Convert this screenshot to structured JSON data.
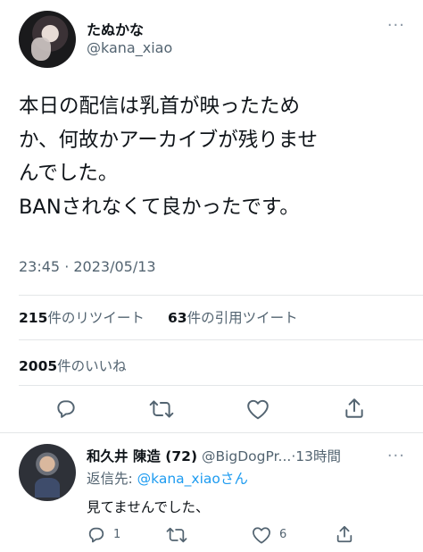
{
  "tweet": {
    "display_name": "たぬかな",
    "handle": "@kana_xiao",
    "more_glyph": "···",
    "text": "本日の配信は乳首が映ったため\nか、何故かアーカイブが残りませ\nんでした。\nBANされなくて良かったです。",
    "timestamp": "23:45 · 2023/05/13",
    "retweets_count": "215",
    "retweets_label": "件のリツイート",
    "quotes_count": "63",
    "quotes_label": "件の引用ツイート",
    "likes_count": "2005",
    "likes_label": "件のいいね"
  },
  "reply": {
    "display_name": "和久井 陳造 (72)",
    "handle": "@BigDogPr...",
    "time": "13時間",
    "more_glyph": "···",
    "reply_to_prefix": "返信先: ",
    "reply_to_mention": "@kana_xiaoさん",
    "text": "見てませんでした、",
    "reply_count": "1",
    "like_count": "6"
  },
  "icons": [
    "reply-icon",
    "retweet-icon",
    "like-icon",
    "share-icon"
  ],
  "colors": {
    "accent": "#1d9bf0",
    "muted": "#536471",
    "text": "#0f1419"
  }
}
